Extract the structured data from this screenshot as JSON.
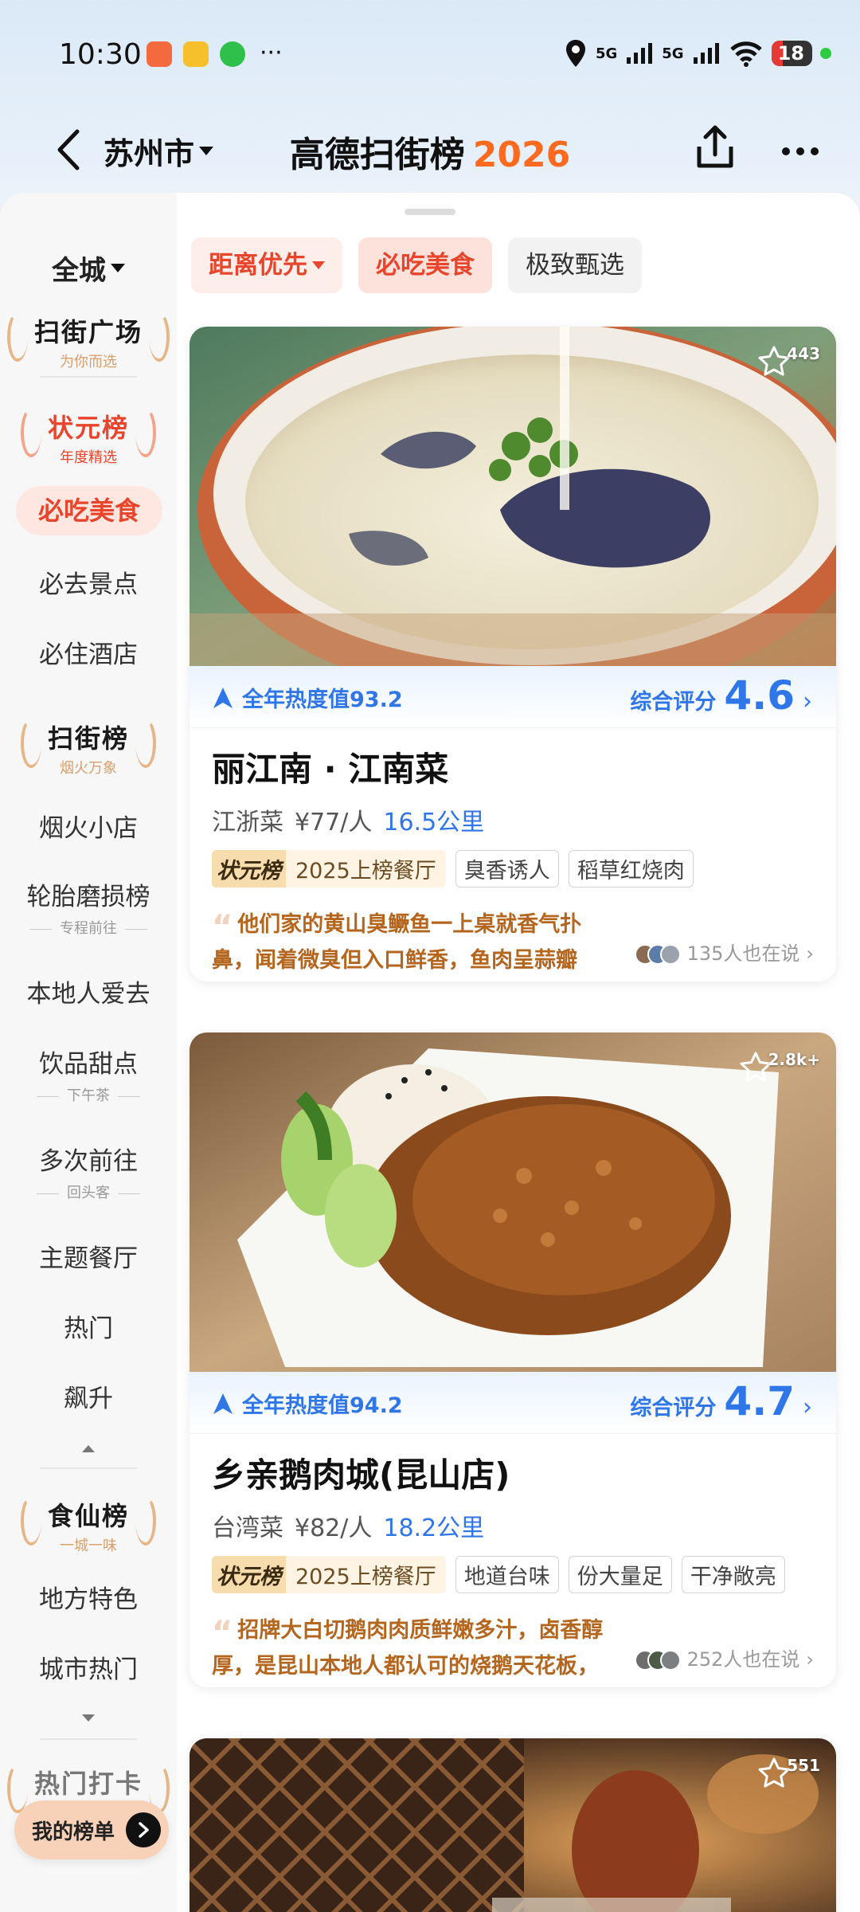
{
  "status_bar": {
    "time": "10:30",
    "signal1": "5G",
    "signal2": "5G",
    "battery": "18"
  },
  "header": {
    "city": "苏州市",
    "title": "高德扫街榜",
    "year": "2026"
  },
  "sidebar": {
    "city_filter": "全城",
    "plaza": {
      "title": "扫街广场",
      "sub": "为你而选"
    },
    "champion": {
      "title": "状元榜",
      "sub": "年度精选"
    },
    "active_item": "必吃美食",
    "items_a": [
      "必去景点",
      "必住酒店"
    ],
    "fireworks": {
      "title": "扫街榜",
      "sub": "烟火万象"
    },
    "items_b": {
      "small_shop": "烟火小店",
      "tire": "轮胎磨损榜",
      "tire_sub": "专程前往",
      "locals": "本地人爱去",
      "drinks": "饮品甜点",
      "drinks_sub": "下午茶",
      "repeat": "多次前往",
      "repeat_sub": "回头客",
      "theme": "主题餐厅",
      "hot": "热门",
      "rising": "飙升"
    },
    "food_immortal": {
      "title": "食仙榜",
      "sub": "一城一味"
    },
    "items_c": [
      "地方特色",
      "城市热门"
    ],
    "checkin": {
      "title": "热门打卡"
    },
    "my_list": "我的榜单"
  },
  "filters": {
    "distance": "距离优先",
    "must_eat": "必吃美食",
    "selection": "极致甄选"
  },
  "cards": [
    {
      "favorites": "443",
      "heat": "全年热度值93.2",
      "rating_label": "综合评分",
      "rating": "4.6",
      "name": "丽江南 · 江南菜",
      "cuisine": "江浙菜",
      "price": "¥77/人",
      "distance": "16.5公里",
      "rank_badge": "状元榜",
      "rank_text": "2025上榜餐厅",
      "tags": [
        "臭香诱人",
        "稻草红烧肉"
      ],
      "review": "他们家的黄山臭鳜鱼一上桌就香气扑鼻，闻着微臭但入口鲜香，鱼肉呈蒜瓣状，嫩滑入味，越...",
      "talking": "135人也在说"
    },
    {
      "favorites": "2.8k+",
      "heat": "全年热度值94.2",
      "rating_label": "综合评分",
      "rating": "4.7",
      "name": "乡亲鹅肉城(昆山店)",
      "cuisine": "台湾菜",
      "price": "¥82/人",
      "distance": "18.2公里",
      "rank_badge": "状元榜",
      "rank_text": "2025上榜餐厅",
      "tags": [
        "地道台味",
        "份大量足",
        "干净敞亮"
      ],
      "review": "招牌大白切鹅肉肉质鲜嫩多汁，卤香醇厚，是昆山本地人都认可的烧鹅天花板，来一趟值得专...",
      "talking": "252人也在说"
    },
    {
      "favorites": "551"
    }
  ],
  "colors": {
    "accent_orange": "#ff6a1f",
    "accent_red": "#e8452c",
    "accent_blue": "#2f76e9",
    "review_brown": "#b4651e"
  }
}
